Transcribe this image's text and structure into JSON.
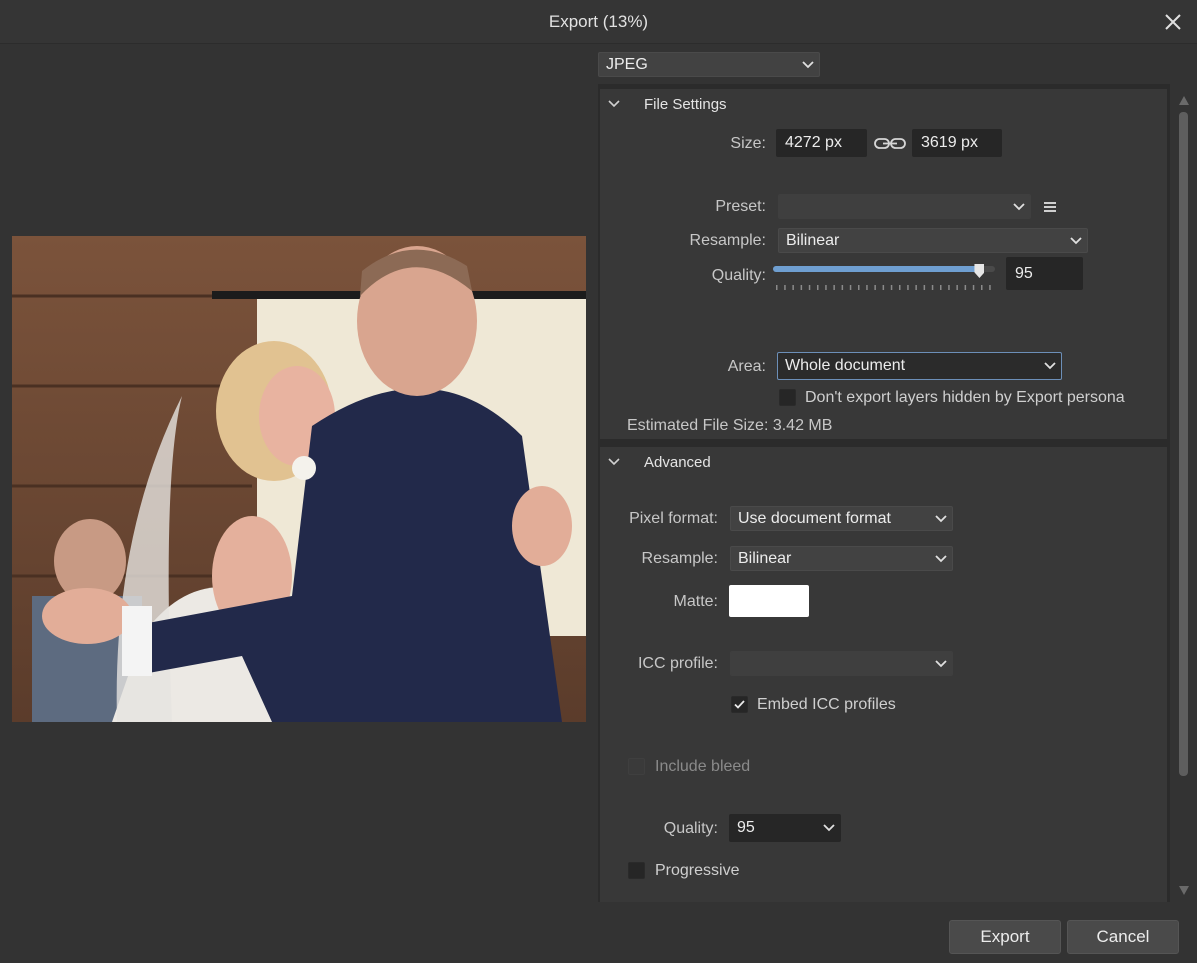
{
  "window": {
    "title": "Export (13%)"
  },
  "format": {
    "selected": "JPEG"
  },
  "file_settings": {
    "header": "File Settings",
    "size_label": "Size:",
    "width_value": "4272 px",
    "height_value": "3619 px",
    "preset_label": "Preset:",
    "preset_value": "",
    "resample_label": "Resample:",
    "resample_value": "Bilinear",
    "quality_label": "Quality:",
    "quality_value": "95",
    "quality_fraction": 0.93,
    "area_label": "Area:",
    "area_value": "Whole document",
    "hidden_layers_label": "Don't export layers hidden by Export persona",
    "hidden_layers_checked": false,
    "estimated_size": "Estimated File Size: 3.42 MB"
  },
  "advanced": {
    "header": "Advanced",
    "pixel_format_label": "Pixel format:",
    "pixel_format_value": "Use document format",
    "resample_label": "Resample:",
    "resample_value": "Bilinear",
    "matte_label": "Matte:",
    "matte_color": "#ffffff",
    "icc_label": "ICC profile:",
    "icc_value": "",
    "embed_icc_label": "Embed ICC profiles",
    "embed_icc_checked": true,
    "include_bleed_label": "Include bleed",
    "include_bleed_checked": false,
    "quality_label": "Quality:",
    "quality_value": "95",
    "progressive_label": "Progressive",
    "progressive_checked": false
  },
  "buttons": {
    "export": "Export",
    "cancel": "Cancel"
  },
  "colors": {
    "accent": "#6f9fd1",
    "background": "#333333",
    "panel": "#383838"
  }
}
